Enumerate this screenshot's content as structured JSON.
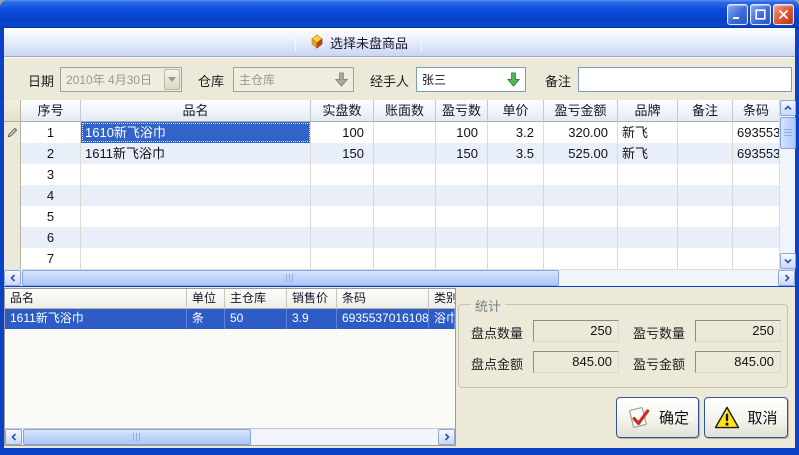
{
  "window": {
    "controls": {
      "minimize": "minimize",
      "maximize": "maximize",
      "close": "close"
    }
  },
  "toolbar": {
    "select_unchecked_label": "选择未盘商品"
  },
  "form": {
    "date_label": "日期",
    "date_value": "2010年 4月30日",
    "warehouse_label": "仓库",
    "warehouse_value": "主仓库",
    "handler_label": "经手人",
    "handler_value": "张三",
    "remark_label": "备注",
    "remark_value": ""
  },
  "main_table": {
    "columns": [
      "序号",
      "品名",
      "实盘数",
      "账面数",
      "盈亏数",
      "单价",
      "盈亏金额",
      "品牌",
      "备注",
      "条码"
    ],
    "rows": [
      {
        "seq": "1",
        "name": "1610新飞浴巾",
        "actual": "100",
        "book": "",
        "diff": "100",
        "price": "3.2",
        "amount": "320.00",
        "brand": "新飞",
        "remark": "",
        "barcode": "693553"
      },
      {
        "seq": "2",
        "name": "1611新飞浴巾",
        "actual": "150",
        "book": "",
        "diff": "150",
        "price": "3.5",
        "amount": "525.00",
        "brand": "新飞",
        "remark": "",
        "barcode": "693553"
      },
      {
        "seq": "3",
        "name": "",
        "actual": "",
        "book": "",
        "diff": "",
        "price": "",
        "amount": "",
        "brand": "",
        "remark": "",
        "barcode": ""
      },
      {
        "seq": "4",
        "name": "",
        "actual": "",
        "book": "",
        "diff": "",
        "price": "",
        "amount": "",
        "brand": "",
        "remark": "",
        "barcode": ""
      },
      {
        "seq": "5",
        "name": "",
        "actual": "",
        "book": "",
        "diff": "",
        "price": "",
        "amount": "",
        "brand": "",
        "remark": "",
        "barcode": ""
      },
      {
        "seq": "6",
        "name": "",
        "actual": "",
        "book": "",
        "diff": "",
        "price": "",
        "amount": "",
        "brand": "",
        "remark": "",
        "barcode": ""
      },
      {
        "seq": "7",
        "name": "",
        "actual": "",
        "book": "",
        "diff": "",
        "price": "",
        "amount": "",
        "brand": "",
        "remark": "",
        "barcode": ""
      }
    ]
  },
  "detail_table": {
    "columns": [
      "品名",
      "单位",
      "主仓库",
      "销售价",
      "条码",
      "类别"
    ],
    "rows": [
      {
        "name": "1611新飞浴巾",
        "unit": "条",
        "stock": "50",
        "price": "3.9",
        "barcode": "6935537016108",
        "category": "浴巾"
      }
    ]
  },
  "stats": {
    "title": "统计",
    "count_qty_label": "盘点数量",
    "count_qty_value": "250",
    "pl_qty_label": "盈亏数量",
    "pl_qty_value": "250",
    "count_amount_label": "盘点金额",
    "count_amount_value": "845.00",
    "pl_amount_label": "盈亏金额",
    "pl_amount_value": "845.00"
  },
  "actions": {
    "ok_label": "确定",
    "cancel_label": "取消"
  },
  "colors": {
    "selection": "#3163C8",
    "titlebar_blue": "#0B47CE",
    "panel_beige": "#ECE9D8",
    "alt_row": "#E9EFF9"
  },
  "icons": {
    "toolbar_button": "gold-box-icon",
    "row_indicator": "pencil-icon",
    "handler_dropdown": "green-down-arrow-icon",
    "warehouse_dropdown": "gray-down-arrow-icon",
    "ok_button": "red-check-icon",
    "cancel_button": "warning-triangle-icon"
  }
}
